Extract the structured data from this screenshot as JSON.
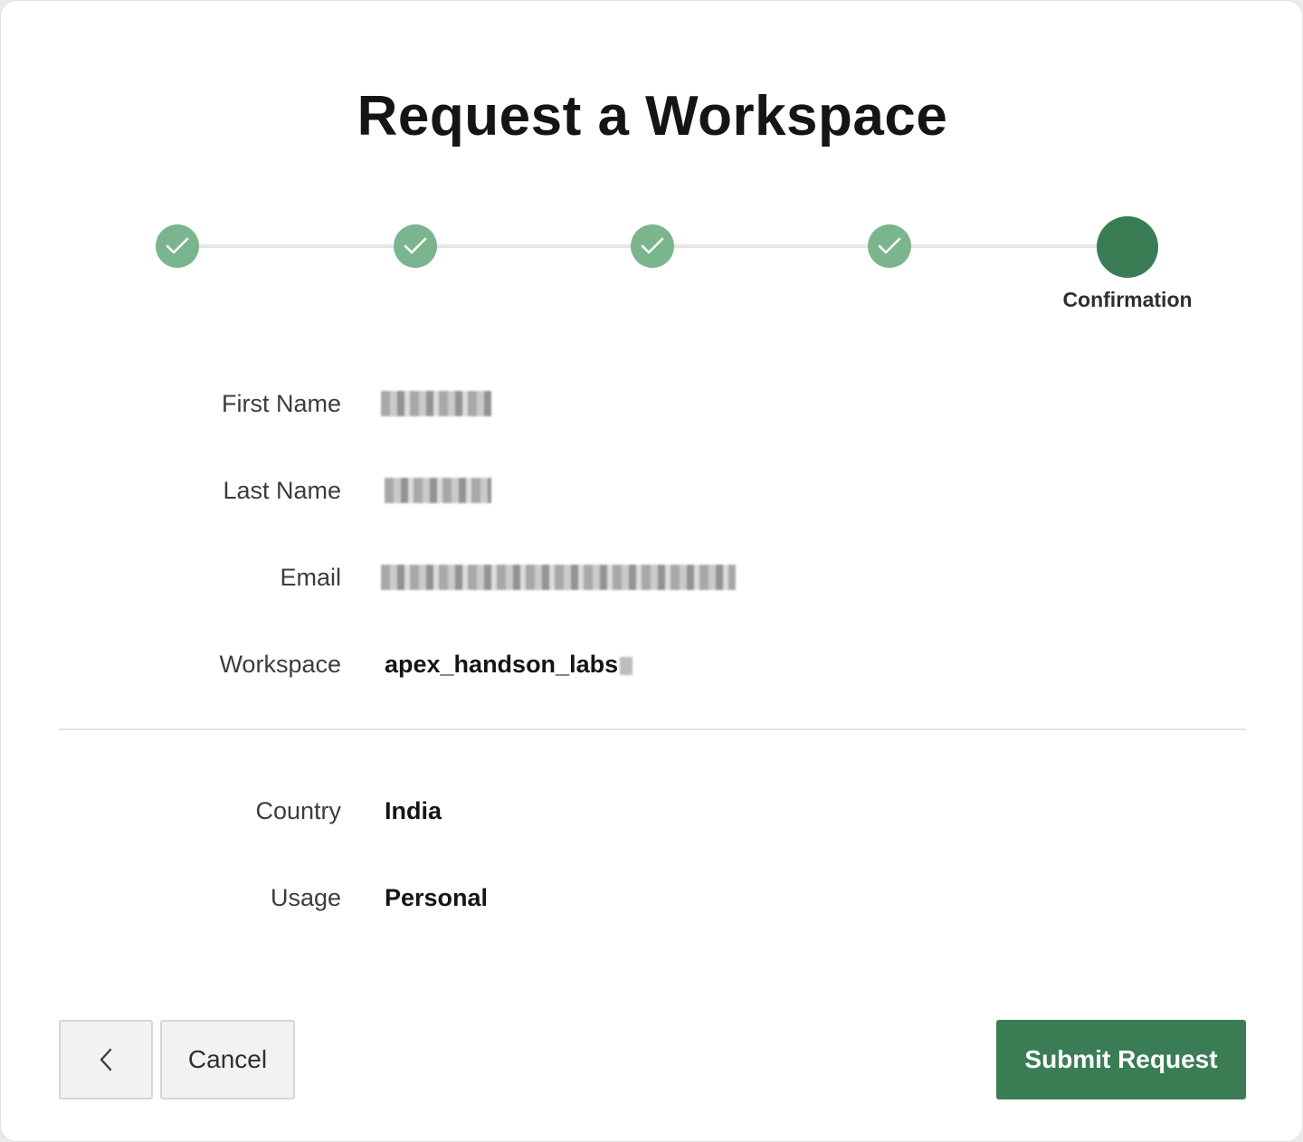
{
  "dialog": {
    "title": "Request a Workspace"
  },
  "progress": {
    "steps": [
      {
        "state": "completed",
        "icon": "checkmark-icon"
      },
      {
        "state": "completed",
        "icon": "checkmark-icon"
      },
      {
        "state": "completed",
        "icon": "checkmark-icon"
      },
      {
        "state": "completed",
        "icon": "checkmark-icon"
      },
      {
        "state": "current",
        "label": "Confirmation"
      }
    ],
    "completed_color": "#7ab58e",
    "current_color": "#3a7d55"
  },
  "details": {
    "first_name": {
      "label": "First Name",
      "value_redacted": true
    },
    "last_name": {
      "label": "Last Name",
      "value_redacted": true
    },
    "email": {
      "label": "Email",
      "value_redacted": true
    },
    "workspace": {
      "label": "Workspace",
      "value": "apex_handson_labs"
    },
    "country": {
      "label": "Country",
      "value": "India"
    },
    "usage": {
      "label": "Usage",
      "value": "Personal"
    }
  },
  "buttons": {
    "back_icon": "chevron-left-icon",
    "cancel": "Cancel",
    "submit": "Submit Request"
  },
  "colors": {
    "primary": "#3a7d55"
  }
}
